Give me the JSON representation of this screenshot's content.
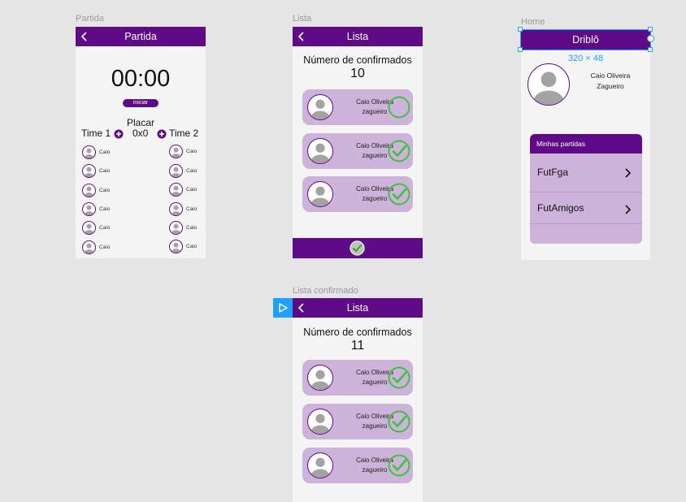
{
  "frames": {
    "partida": {
      "label": "Partida",
      "title": "Partida",
      "timer": "00:00",
      "start_button": "iniciar",
      "score_title": "Placar",
      "team1": "Time 1",
      "score": "0x0",
      "team2": "Time 2",
      "players_left": [
        "Caio",
        "Caio",
        "Caio",
        "Caio",
        "Caio",
        "Caio"
      ],
      "players_right": [
        "Caio",
        "Caio",
        "Caio",
        "Caio",
        "Caio",
        "Caio"
      ]
    },
    "lista": {
      "label": "Lista",
      "title": "Lista",
      "confirmed_label": "Número de confirmados",
      "confirmed_count": "10",
      "players": [
        {
          "name": "Caio Oliveira",
          "position": "zagueiro",
          "confirmed": false
        },
        {
          "name": "Caio Oliveira",
          "position": "zagueiro",
          "confirmed": true
        },
        {
          "name": "Caio Oliveira",
          "position": "zagueiro",
          "confirmed": true
        }
      ]
    },
    "home": {
      "label": "Home",
      "title": "Driblô",
      "size_badge": "320 × 48",
      "user_name": "Caio Oliveira",
      "user_position": "Zagueiro",
      "matches_header": "Minhas partidas",
      "matches": [
        "FutFga",
        "FutAmigos"
      ]
    },
    "lista_confirmado": {
      "label": "Lista confirmado",
      "title": "Lista",
      "confirmed_label": "Número de confirmados",
      "confirmed_count": "11",
      "players": [
        {
          "name": "Caio Oliveira",
          "position": "zagueiro",
          "confirmed": true
        },
        {
          "name": "Caio Oliveira",
          "position": "zagueiro",
          "confirmed": true
        },
        {
          "name": "Caio Oliveira",
          "position": "zagueiro",
          "confirmed": true
        }
      ]
    }
  },
  "icons": {
    "back": "chevron-left-icon",
    "check": "check-circle-icon",
    "add": "plus-circle-icon",
    "play": "play-icon",
    "chevron_right": "chevron-right-icon"
  },
  "colors": {
    "primary": "#5f0a87",
    "card": "#cdb2d9",
    "check_green": "#3cc43c",
    "selection": "#1ea0ff",
    "canvas": "#e5e5e5"
  }
}
